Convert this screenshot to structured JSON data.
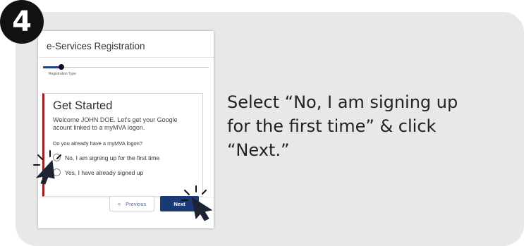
{
  "step_badge": "4",
  "colors": {
    "card_bg": "#e8e8ea",
    "accent_red": "#a01c20",
    "primary_button": "#1b3a75",
    "stepper_active": "#1f3f8f"
  },
  "screenshot": {
    "title": "e-Services Registration",
    "stepper": {
      "label": "Registration Type"
    },
    "panel": {
      "heading": "Get Started",
      "welcome": "Welcome JOHN DOE. Let's get your Google acount linked to a myMVA logon.",
      "question": "Do you already have a myMVA logon?",
      "options": [
        {
          "label": "No, I am signing up for the first time",
          "selected": false
        },
        {
          "label": "Yes, I have already signed up",
          "selected": false
        }
      ]
    },
    "buttons": {
      "previous_icon": "<",
      "previous": "Previous",
      "next": "Next"
    }
  },
  "icons": [
    "click-cursor-icon",
    "click-cursor-icon"
  ],
  "instruction": "Select “No, I am signing up for the first time” & click “Next.”"
}
